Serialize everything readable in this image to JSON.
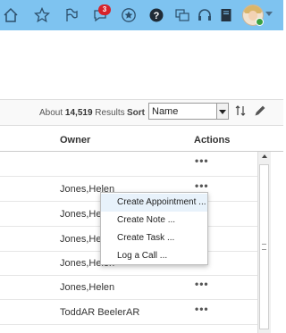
{
  "topbar": {
    "background": "#7ec3f0",
    "icons": [
      "home-icon",
      "star-icon",
      "flag-icon",
      "notifications-icon",
      "star-circle-icon",
      "help-icon",
      "recent-pages-icon",
      "headset-icon",
      "book-icon",
      "avatar"
    ],
    "notification_count": "3"
  },
  "results": {
    "prefix": "About",
    "count": "14,519",
    "suffix": "Results",
    "sort_label": "Sort",
    "sort_value": "Name"
  },
  "table": {
    "columns": [
      "Owner",
      "Actions"
    ],
    "rows": [
      {
        "owner": "",
        "action": "•••"
      },
      {
        "owner": "Jones,Helen",
        "action": "•••"
      },
      {
        "owner": "Jones,Helen",
        "action": "•••"
      },
      {
        "owner": "Jones,Helen",
        "action": "•••"
      },
      {
        "owner": "Jones,Helen",
        "action": "•••"
      },
      {
        "owner": "Jones,Helen",
        "action": "•••"
      },
      {
        "owner": "Jones,Helen",
        "action": "•••"
      },
      {
        "owner": "ToddAR BeelerAR",
        "action": "•••"
      }
    ]
  },
  "context_menu": {
    "items": [
      "Create Appointment ...",
      "Create Note ...",
      "Create Task ...",
      "Log a Call ..."
    ]
  }
}
